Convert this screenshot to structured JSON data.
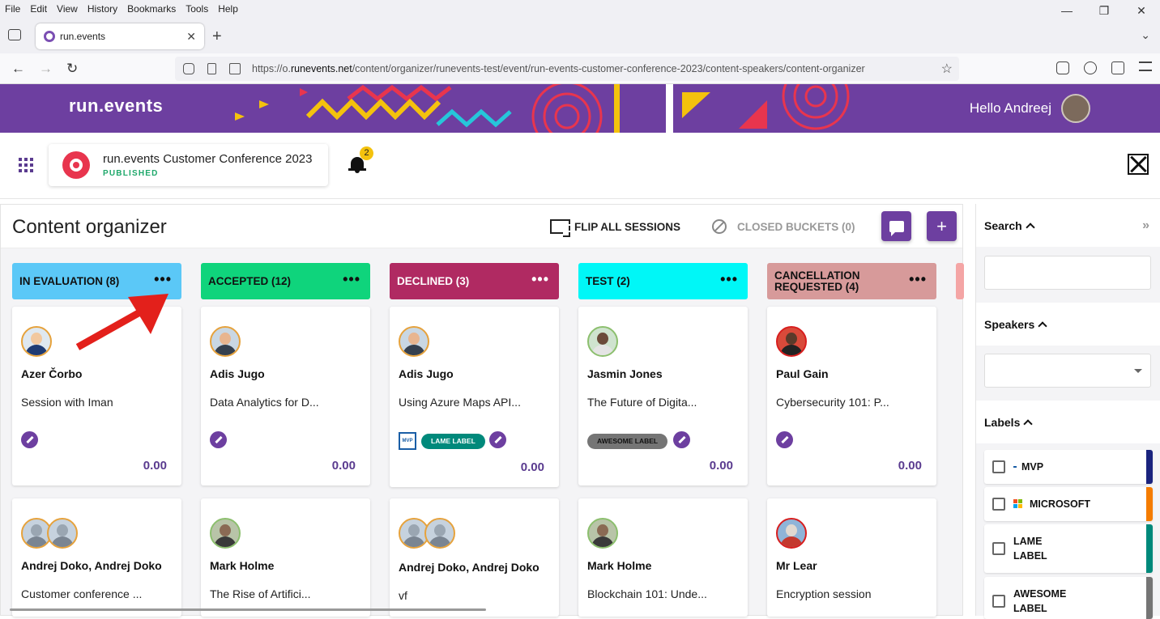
{
  "browser": {
    "menu": [
      "File",
      "Edit",
      "View",
      "History",
      "Bookmarks",
      "Tools",
      "Help"
    ],
    "tab_title": "run.events",
    "url_prefix": "https://o.",
    "url_domain": "runevents.net",
    "url_path": "/content/organizer/runevents-test/event/run-events-customer-conference-2023/content-speakers/content-organizer"
  },
  "banner": {
    "brand": "run.events",
    "greeting": "Hello Andreej"
  },
  "event": {
    "title": "run.events Customer Conference 2023",
    "status": "PUBLISHED",
    "notification_count": "2"
  },
  "organizer": {
    "title": "Content organizer",
    "flip_label": "FLIP ALL SESSIONS",
    "closed_label": "CLOSED BUCKETS (0)"
  },
  "buckets": [
    {
      "name": "IN EVALUATION (8)",
      "color": "#5bc8f7",
      "cards": [
        {
          "speaker": "Azer Čorbo",
          "title": "Session with Iman",
          "score": "0.00"
        },
        {
          "speaker": "Andrej Doko, Andrej Doko",
          "title": "Customer conference ...",
          "score": ""
        }
      ]
    },
    {
      "name": "ACCEPTED (12)",
      "color": "#0fd47c",
      "cards": [
        {
          "speaker": "Adis Jugo",
          "title": "Data Analytics for D...",
          "score": "0.00"
        },
        {
          "speaker": "Mark Holme",
          "title": "The Rise of Artifici...",
          "score": ""
        }
      ]
    },
    {
      "name": "DECLINED (3)",
      "color": "#b02a62",
      "cards": [
        {
          "speaker": "Adis Jugo",
          "title": "Using Azure Maps API...",
          "score": "0.00",
          "labels": [
            "LAME LABEL"
          ],
          "badge": "MVP"
        },
        {
          "speaker": "Andrej Doko, Andrej Doko",
          "title": "vf",
          "score": ""
        }
      ]
    },
    {
      "name": "TEST (2)",
      "color": "#00f7f7",
      "cards": [
        {
          "speaker": "Jasmin Jones",
          "title": "The Future of Digita...",
          "score": "0.00",
          "labels": [
            "AWESOME LABEL"
          ]
        },
        {
          "speaker": "Mark Holme",
          "title": "Blockchain 101: Unde...",
          "score": ""
        }
      ]
    },
    {
      "name": "CANCELLATION REQUESTED (4)",
      "color": "#d79a9a",
      "cards": [
        {
          "speaker": "Paul Gain",
          "title": "Cybersecurity 101: P...",
          "score": "0.00"
        },
        {
          "speaker": "Mr Lear",
          "title": "Encryption session",
          "score": ""
        }
      ]
    }
  ],
  "sidebar": {
    "search_label": "Search",
    "speakers_label": "Speakers",
    "labels_label": "Labels",
    "labels": [
      {
        "name": "MVP",
        "color": "#1a237e"
      },
      {
        "name": "MICROSOFT",
        "color": "#f57c00"
      },
      {
        "name": "LAME LABEL",
        "color": "#00897b"
      },
      {
        "name": "AWESOME LABEL",
        "color": "#757575"
      }
    ]
  }
}
